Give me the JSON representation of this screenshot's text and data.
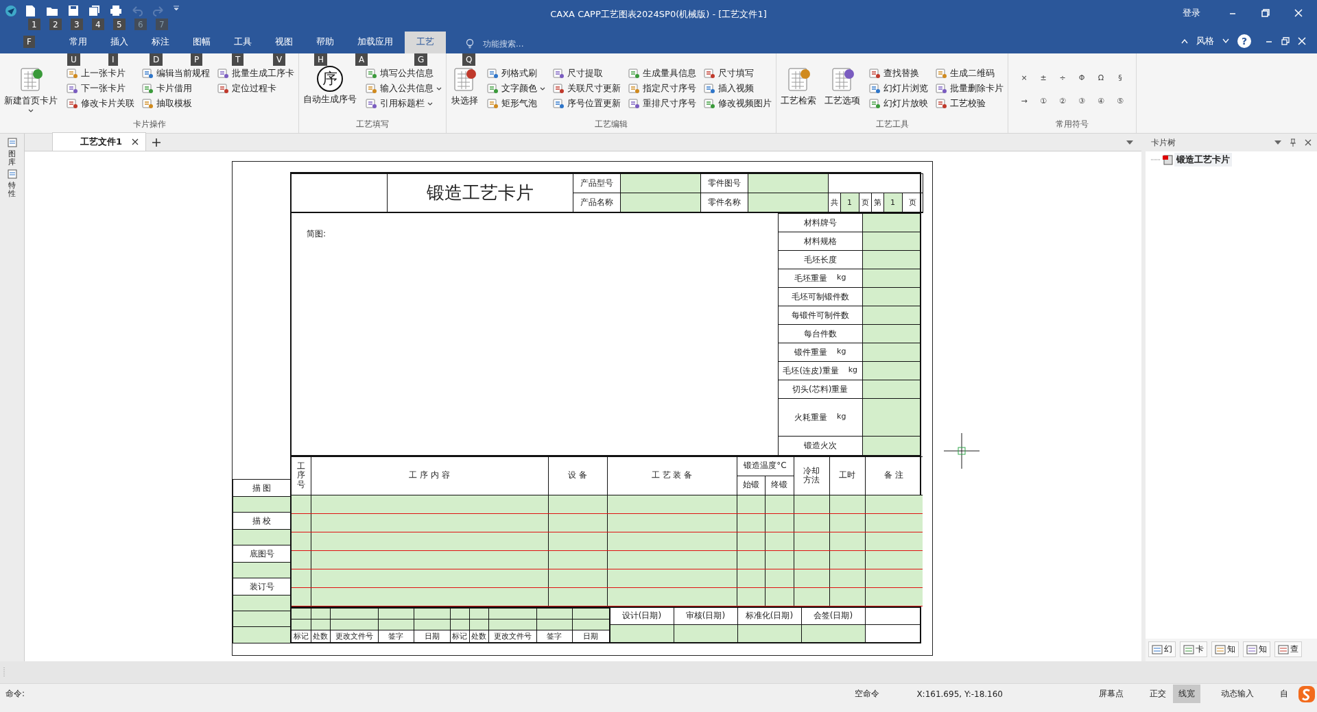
{
  "title_bar": {
    "title": "CAXA CAPP工艺图表2024SP0(机械版) - [工艺文件1]",
    "login": "登录"
  },
  "quick_access": [
    {
      "kind": "new",
      "keytip": "1",
      "disabled": false
    },
    {
      "kind": "open",
      "keytip": "2",
      "disabled": false
    },
    {
      "kind": "save",
      "keytip": "3",
      "disabled": false
    },
    {
      "kind": "saveas",
      "keytip": "4",
      "disabled": false
    },
    {
      "kind": "print",
      "keytip": "5",
      "disabled": false
    },
    {
      "kind": "undo",
      "keytip": "6",
      "disabled": true
    },
    {
      "kind": "redo",
      "keytip": "7",
      "disabled": true
    }
  ],
  "file_keytip": "F",
  "menu_tabs": [
    {
      "label": "常用",
      "keytip": "U",
      "selected": false
    },
    {
      "label": "插入",
      "keytip": "I",
      "selected": false
    },
    {
      "label": "标注",
      "keytip": "D",
      "selected": false
    },
    {
      "label": "图幅",
      "keytip": "P",
      "selected": false
    },
    {
      "label": "工具",
      "keytip": "T",
      "selected": false
    },
    {
      "label": "视图",
      "keytip": "V",
      "selected": false
    },
    {
      "label": "帮助",
      "keytip": "H",
      "selected": false
    },
    {
      "label": "加载应用",
      "keytip": "A",
      "selected": false
    },
    {
      "label": "工艺",
      "keytip": "G",
      "selected": true
    }
  ],
  "search": {
    "placeholder": "功能搜索...",
    "keytip": "Q"
  },
  "style_menu": "风格",
  "help": "?",
  "ribbon_groups": [
    {
      "label": "卡片操作",
      "items": [
        {
          "label": "新建首页卡片",
          "kind": "large",
          "dropdown": true
        },
        {
          "label": "上一张卡片",
          "kind": "small",
          "dropdown": false
        },
        {
          "label": "下一张卡片",
          "kind": "small",
          "dropdown": false
        },
        {
          "label": "修改卡片关联",
          "kind": "small",
          "dropdown": false
        },
        {
          "label": "编辑当前规程",
          "kind": "small",
          "dropdown": false
        },
        {
          "label": "卡片借用",
          "kind": "small",
          "dropdown": false
        },
        {
          "label": "抽取模板",
          "kind": "small",
          "dropdown": false
        },
        {
          "label": "批量生成工序卡",
          "kind": "small",
          "dropdown": false
        },
        {
          "label": "定位过程卡",
          "kind": "small",
          "dropdown": false
        }
      ]
    },
    {
      "label": "工艺填写",
      "items": [
        {
          "label": "自动生成序号",
          "kind": "large",
          "dropdown": false,
          "glyph": "序"
        },
        {
          "label": "填写公共信息",
          "kind": "small",
          "dropdown": false
        },
        {
          "label": "输入公共信息",
          "kind": "small",
          "dropdown": true
        },
        {
          "label": "引用标题栏",
          "kind": "small",
          "dropdown": true
        }
      ]
    },
    {
      "label": "工艺编辑",
      "items": [
        {
          "label": "块选择",
          "kind": "large",
          "dropdown": false
        },
        {
          "label": "列格式刷",
          "kind": "small",
          "dropdown": false
        },
        {
          "label": "文字颜色",
          "kind": "small",
          "dropdown": true
        },
        {
          "label": "矩形气泡",
          "kind": "small",
          "dropdown": false
        },
        {
          "label": "尺寸提取",
          "kind": "small",
          "dropdown": false
        },
        {
          "label": "关联尺寸更新",
          "kind": "small",
          "dropdown": false
        },
        {
          "label": "序号位置更新",
          "kind": "small",
          "dropdown": false
        },
        {
          "label": "生成量具信息",
          "kind": "small",
          "dropdown": false
        },
        {
          "label": "指定尺寸序号",
          "kind": "small",
          "dropdown": false
        },
        {
          "label": "重排尺寸序号",
          "kind": "small",
          "dropdown": false
        },
        {
          "label": "尺寸填写",
          "kind": "small",
          "dropdown": false
        },
        {
          "label": "插入视频",
          "kind": "small",
          "dropdown": false
        },
        {
          "label": "修改视频图片",
          "kind": "small",
          "dropdown": false
        }
      ]
    },
    {
      "label": "工艺工具",
      "items": [
        {
          "label": "工艺检索",
          "kind": "large",
          "dropdown": false
        },
        {
          "label": "工艺选项",
          "kind": "large",
          "dropdown": false
        },
        {
          "label": "查找替换",
          "kind": "small",
          "dropdown": false
        },
        {
          "label": "幻灯片浏览",
          "kind": "small",
          "dropdown": false
        },
        {
          "label": "幻灯片放映",
          "kind": "small",
          "dropdown": false
        },
        {
          "label": "生成二维码",
          "kind": "small",
          "dropdown": false
        },
        {
          "label": "批量删除卡片",
          "kind": "small",
          "dropdown": false
        },
        {
          "label": "工艺校验",
          "kind": "small",
          "dropdown": false
        }
      ]
    },
    {
      "label": "常用符号",
      "items": [
        {
          "label": "×",
          "kind": "symbol"
        },
        {
          "label": "±",
          "kind": "symbol"
        },
        {
          "label": "÷",
          "kind": "symbol"
        },
        {
          "label": "Φ",
          "kind": "symbol"
        },
        {
          "label": "Ω",
          "kind": "symbol"
        },
        {
          "label": "§",
          "kind": "symbol"
        },
        {
          "label": "→",
          "kind": "symbol"
        },
        {
          "label": "①",
          "kind": "symbol"
        },
        {
          "label": "②",
          "kind": "symbol"
        },
        {
          "label": "③",
          "kind": "symbol"
        },
        {
          "label": "④",
          "kind": "symbol"
        },
        {
          "label": "⑤",
          "kind": "symbol"
        }
      ]
    }
  ],
  "side_strip": [
    "图库",
    "特性"
  ],
  "doc_tabs": [
    {
      "label": "工艺文件1",
      "selected": true
    }
  ],
  "card": {
    "title": "锻造工艺卡片",
    "header_fields": [
      "产品型号",
      "零件图号",
      "产品名称",
      "零件名称"
    ],
    "page_info": {
      "total_prefix": "共",
      "total": "1",
      "total_suffix": "页",
      "current_prefix": "第",
      "current": "1",
      "current_suffix": "页"
    },
    "sketch_label": "简图:",
    "material_rows": [
      {
        "label": "材料牌号",
        "kind": "single"
      },
      {
        "label": "材料规格",
        "kind": "single"
      },
      {
        "label": "毛坯长度",
        "kind": "single"
      },
      {
        "label": "毛坯重量",
        "unit": "kg",
        "kind": "single"
      },
      {
        "label": "毛坯可制锻件数",
        "kind": "single"
      },
      {
        "label": "每锻件可制件数",
        "kind": "single"
      },
      {
        "label": "每台件数",
        "kind": "single"
      },
      {
        "label": "锻件重量",
        "unit": "kg",
        "kind": "single"
      },
      {
        "label": "毛坯(连皮)重量",
        "unit": "kg",
        "kind": "single"
      },
      {
        "label": "切头(芯料)重量",
        "kind": "single"
      },
      {
        "label": "火耗重量",
        "unit": "kg",
        "kind": "double"
      },
      {
        "label": "锻造火次",
        "kind": "single"
      }
    ],
    "process_columns": [
      "工序号",
      "工 序 内 容",
      "设 备",
      "工 艺 装 备",
      "冷却方法",
      "工时",
      "备 注"
    ],
    "temperature_group": {
      "label": "锻造温度°C",
      "sub": [
        "始锻",
        "终锻"
      ]
    },
    "side_labels": [
      "描 图",
      "描 校",
      "底图号",
      "装订号"
    ],
    "revision_labels": [
      "标记",
      "处数",
      "更改文件号",
      "签字",
      "日期",
      "标记",
      "处数",
      "更改文件号",
      "签字",
      "日期"
    ],
    "approval_labels": [
      "设计(日期)",
      "审核(日期)",
      "标准化(日期)",
      "会签(日期)"
    ]
  },
  "right_panel": {
    "title": "卡片树",
    "tree": [
      {
        "label": "锻造工艺卡片",
        "selected": true
      }
    ],
    "bottom_tabs": [
      "幻",
      "卡",
      "知",
      "知",
      "查"
    ]
  },
  "status_bar": {
    "command_label": "命令:",
    "state": "空命令",
    "coords": "X:161.695, Y:-18.160",
    "toggles": [
      {
        "label": "屏幕点",
        "on": false
      },
      {
        "label": "正交",
        "on": false
      },
      {
        "label": "线宽",
        "on": true
      },
      {
        "label": "动态输入",
        "on": false
      },
      {
        "label": "自",
        "on": false
      }
    ]
  }
}
